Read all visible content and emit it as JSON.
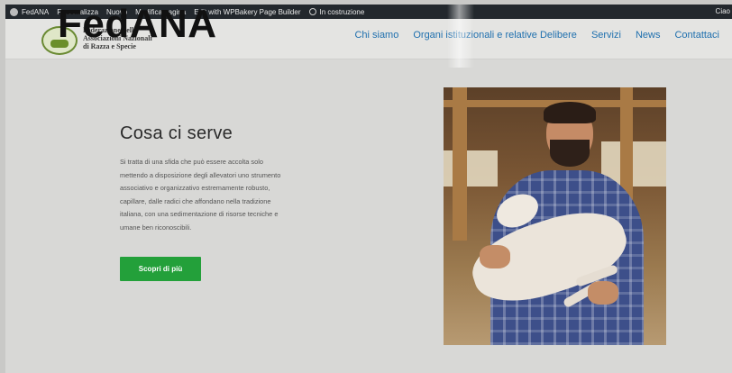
{
  "adminbar": {
    "items": [
      {
        "label": "FedANA"
      },
      {
        "label": "Personalizza"
      },
      {
        "label": "Nuovo"
      },
      {
        "label": "Modifica pagina"
      },
      {
        "label": "Edit with WPBakery Page Builder"
      },
      {
        "label": "In costruzione"
      }
    ],
    "right_label": "Ciao"
  },
  "overlay_brand": "FedANA",
  "header": {
    "logo_text_lines": [
      "Federazione delle",
      "Associazioni Nazionali",
      "di Razza e Specie"
    ],
    "nav": [
      "Chi siamo",
      "Organi istituzionali e relative Delibere",
      "Servizi",
      "News",
      "Contattaci"
    ]
  },
  "hero": {
    "heading": "Cosa ci serve",
    "body_lines": [
      "Si tratta di una sfida che può essere accolta solo",
      "mettendo a disposizione degli allevatori uno strumento",
      "associativo e organizzativo estremamente robusto,",
      "capillare, dalle radici che affondano nella tradizione",
      "italiana, con una sedimentazione di risorse tecniche e",
      "umane ben riconoscibili."
    ],
    "cta_label": "Scopri di più"
  },
  "colors": {
    "adminbar": "#23282d",
    "nav_link": "#1e6fae",
    "cta": "#23a03a"
  }
}
